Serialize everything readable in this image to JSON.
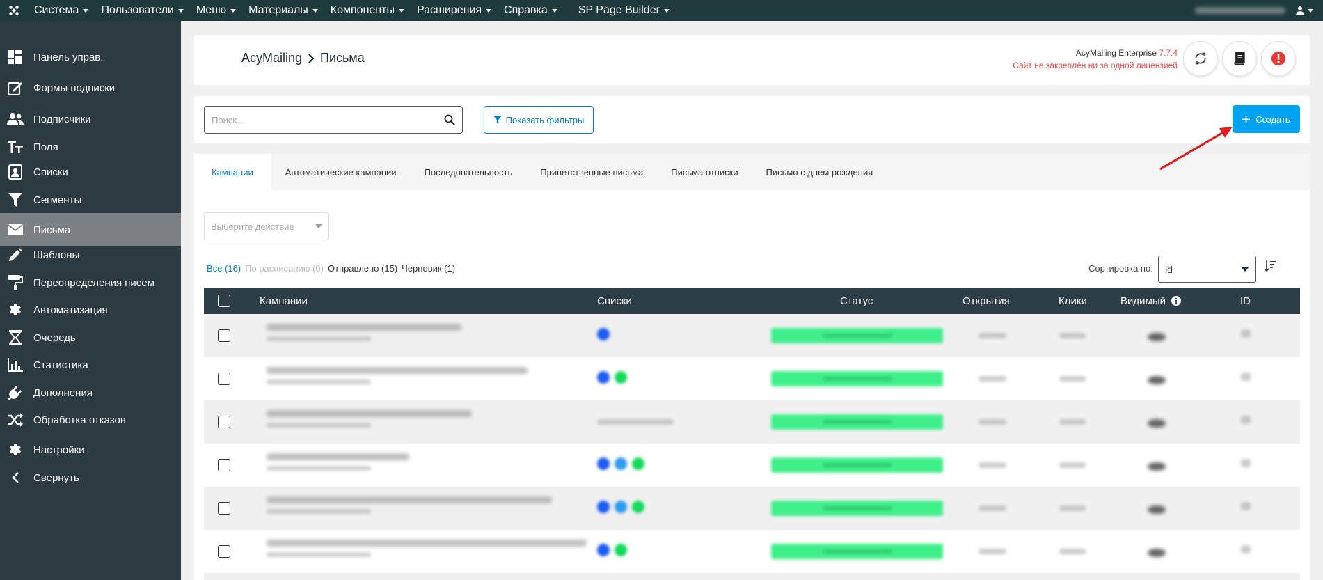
{
  "topbar": {
    "menu": [
      {
        "label": "Система"
      },
      {
        "label": "Пользователи"
      },
      {
        "label": "Меню"
      },
      {
        "label": "Материалы"
      },
      {
        "label": "Компоненты"
      },
      {
        "label": "Расширения"
      },
      {
        "label": "Справка"
      },
      {
        "label": "SP Page Builder"
      }
    ]
  },
  "sidebar": {
    "items": [
      {
        "label": "Панель управ.",
        "icon": "dashboard-icon"
      },
      {
        "label": "Формы подписки",
        "icon": "edit-form-icon"
      },
      {
        "label": "Подписчики",
        "icon": "users-icon"
      },
      {
        "label": "Поля",
        "icon": "text-fields-icon"
      },
      {
        "label": "Списки",
        "icon": "contact-list-icon"
      },
      {
        "label": "Сегменты",
        "icon": "funnel-icon"
      },
      {
        "label": "Письма",
        "icon": "envelope-icon",
        "active": true
      },
      {
        "label": "Шаблоны",
        "icon": "pencil-icon"
      },
      {
        "label": "Переопределения писем",
        "icon": "paint-roller-icon"
      },
      {
        "label": "Автоматизация",
        "icon": "gear-icon"
      },
      {
        "label": "Очередь",
        "icon": "hourglass-icon"
      },
      {
        "label": "Статистика",
        "icon": "bar-chart-icon"
      },
      {
        "label": "Дополнения",
        "icon": "plug-icon"
      },
      {
        "label": "Обработка отказов",
        "icon": "shuffle-icon"
      },
      {
        "label": "Настройки",
        "icon": "settings-icon"
      },
      {
        "label": "Свернуть",
        "icon": "chevron-left-icon"
      }
    ]
  },
  "header": {
    "breadcrumb_root": "AcyMailing",
    "breadcrumb_current": "Письма",
    "product_name": "AcyMailing Enterprise",
    "version": "7.7.4",
    "license_warning": "Сайт не закреплён ни за одной лицензией"
  },
  "toolbar": {
    "search_placeholder": "Поиск...",
    "filters_label": "Показать фильтры",
    "create_label": "Создать"
  },
  "tabs": [
    {
      "label": "Кампании",
      "active": true
    },
    {
      "label": "Автоматические кампании"
    },
    {
      "label": "Последовательность"
    },
    {
      "label": "Приветственные письма"
    },
    {
      "label": "Письма отписки"
    },
    {
      "label": "Письмо с днем рождения"
    }
  ],
  "list": {
    "action_placeholder": "Выберите действие",
    "filter_all": "Все (16)",
    "filter_scheduled": "По расписанию (0)",
    "filter_sent": "Отправлено (15)",
    "filter_draft": "Черновик (1)",
    "sort_label": "Сортировка по:",
    "sort_value": "id"
  },
  "table": {
    "columns": {
      "campaigns": "Кампании",
      "lists": "Списки",
      "status": "Статус",
      "opens": "Открытия",
      "clicks": "Клики",
      "visible": "Видимый",
      "id": "ID"
    }
  },
  "colors": {
    "topbar_bg": "#1f3a3d",
    "sidebar_bg": "#2c3a42",
    "sidebar_active": "#7b8084",
    "accent": "#00a2f2",
    "link": "#0a7bbf",
    "warning": "#e84a4a",
    "table_header": "#2d3e48",
    "status_green": "#3ff08a"
  }
}
